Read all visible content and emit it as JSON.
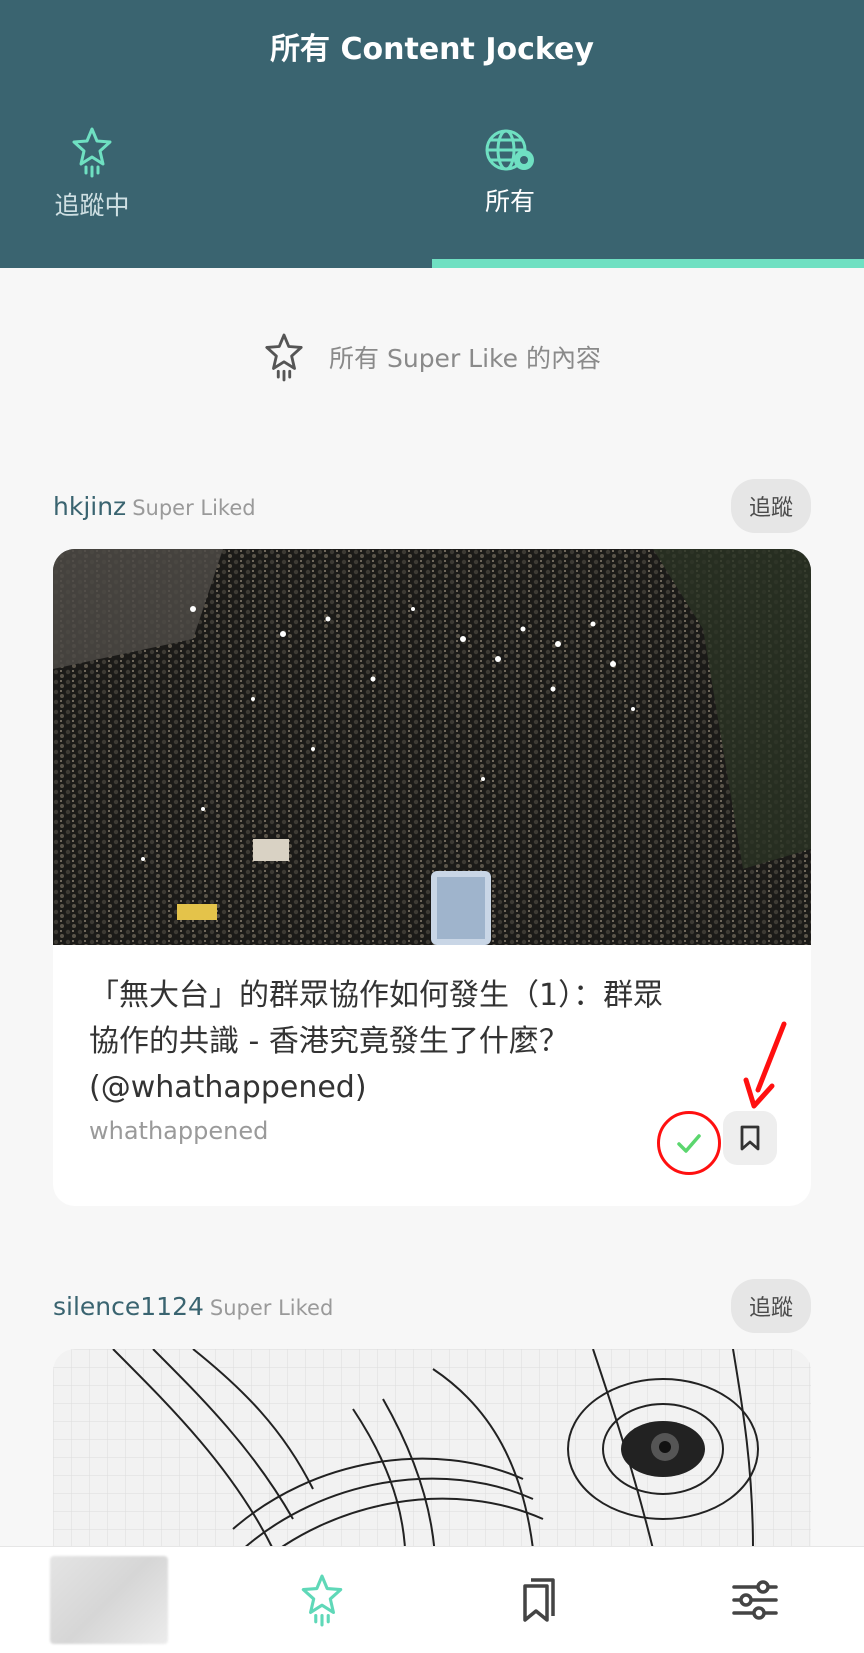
{
  "header": {
    "title": "所有 Content Jockey",
    "tabs": [
      {
        "label": "追蹤中",
        "icon": "star-icon"
      },
      {
        "label": "所有",
        "icon": "globe-icon",
        "active": true
      }
    ]
  },
  "banner": {
    "text": "所有 Super Like 的內容",
    "icon": "star-icon"
  },
  "feed": [
    {
      "author": "hkjinz",
      "action": "Super Liked",
      "follow_label": "追蹤",
      "title": "「無大台」的群眾協作如何發生（1）：群眾協作的共識 - 香港究竟發生了什麼？(@whathappened)",
      "source": "whathappened",
      "image": "crowd-photo"
    },
    {
      "author": "silence1124",
      "action": "Super Liked",
      "follow_label": "追蹤",
      "image": "sketch-drawing"
    }
  ],
  "bottom_nav": [
    {
      "name": "avatar"
    },
    {
      "name": "star-icon",
      "active": true
    },
    {
      "name": "bookmarks-icon"
    },
    {
      "name": "settings-sliders-icon"
    }
  ],
  "colors": {
    "header_bg": "#3a6470",
    "accent": "#6fe0c2",
    "check": "#5bd66e",
    "annotation": "#ff1010"
  }
}
